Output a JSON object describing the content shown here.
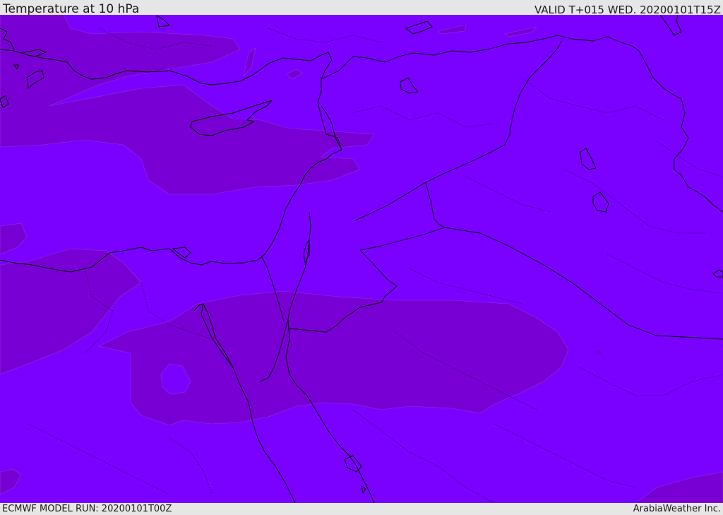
{
  "header": {
    "title": "Temperature at 10 hPa",
    "valid": "VALID T+015 WED. 20200101T15Z"
  },
  "footer": {
    "model_run": "ECMWF MODEL RUN: 20200101T00Z",
    "credit": "ArabiaWeather Inc."
  },
  "map": {
    "region": "Eastern Mediterranean & Middle East",
    "field": "temperature",
    "level": "10 hPa",
    "colors": {
      "base_shade": "#7a00ff",
      "darker_shade": "#7800d4",
      "coastline": "#000000"
    }
  }
}
